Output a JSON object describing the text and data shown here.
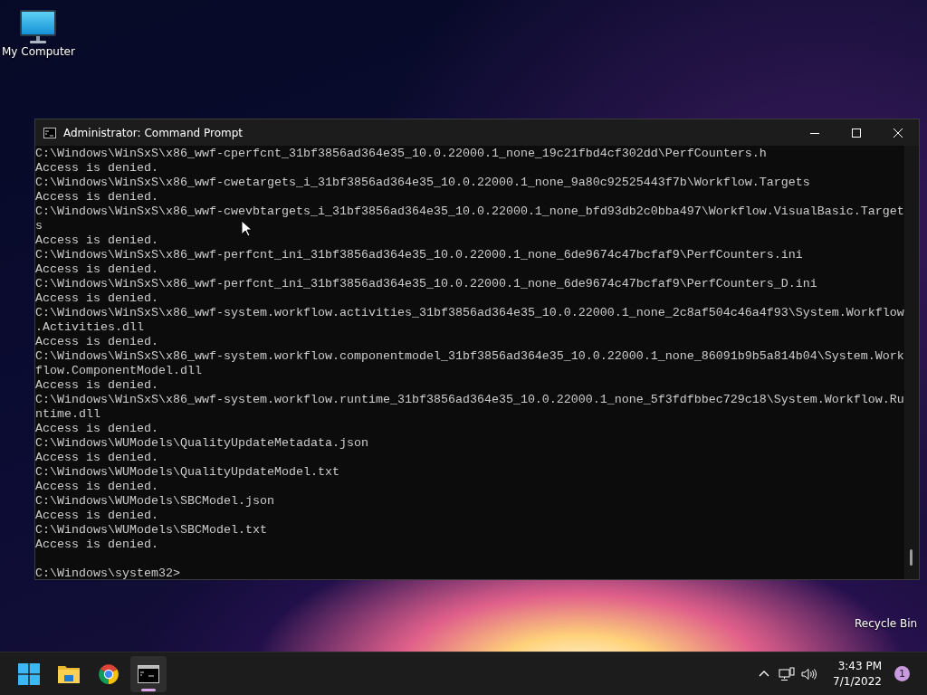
{
  "desktop_icons": [
    {
      "kind": "computer",
      "label": "My Computer"
    },
    {
      "kind": "recycle-bin",
      "label": "Recycle Bin"
    }
  ],
  "window": {
    "title": "Administrator: Command Prompt",
    "lines": [
      "C:\\Windows\\WinSxS\\x86_wwf-cperfcnt_31bf3856ad364e35_10.0.22000.1_none_19c21fbd4cf302dd\\PerfCounters.h",
      "Access is denied.",
      "C:\\Windows\\WinSxS\\x86_wwf-cwetargets_i_31bf3856ad364e35_10.0.22000.1_none_9a80c92525443f7b\\Workflow.Targets",
      "Access is denied.",
      "C:\\Windows\\WinSxS\\x86_wwf-cwevbtargets_i_31bf3856ad364e35_10.0.22000.1_none_bfd93db2c0bba497\\Workflow.VisualBasic.Target",
      "s",
      "Access is denied.",
      "C:\\Windows\\WinSxS\\x86_wwf-perfcnt_ini_31bf3856ad364e35_10.0.22000.1_none_6de9674c47bcfaf9\\PerfCounters.ini",
      "Access is denied.",
      "C:\\Windows\\WinSxS\\x86_wwf-perfcnt_ini_31bf3856ad364e35_10.0.22000.1_none_6de9674c47bcfaf9\\PerfCounters_D.ini",
      "Access is denied.",
      "C:\\Windows\\WinSxS\\x86_wwf-system.workflow.activities_31bf3856ad364e35_10.0.22000.1_none_2c8af504c46a4f93\\System.Workflow",
      ".Activities.dll",
      "Access is denied.",
      "C:\\Windows\\WinSxS\\x86_wwf-system.workflow.componentmodel_31bf3856ad364e35_10.0.22000.1_none_86091b9b5a814b04\\System.Work",
      "flow.ComponentModel.dll",
      "Access is denied.",
      "C:\\Windows\\WinSxS\\x86_wwf-system.workflow.runtime_31bf3856ad364e35_10.0.22000.1_none_5f3fdfbbec729c18\\System.Workflow.Ru",
      "ntime.dll",
      "Access is denied.",
      "C:\\Windows\\WUModels\\QualityUpdateMetadata.json",
      "Access is denied.",
      "C:\\Windows\\WUModels\\QualityUpdateModel.txt",
      "Access is denied.",
      "C:\\Windows\\WUModels\\SBCModel.json",
      "Access is denied.",
      "C:\\Windows\\WUModels\\SBCModel.txt",
      "Access is denied."
    ],
    "prompt": "C:\\Windows\\system32>"
  },
  "taskbar": {
    "apps": [
      {
        "kind": "start",
        "active": false
      },
      {
        "kind": "folder",
        "active": false
      },
      {
        "kind": "browser",
        "active": false
      },
      {
        "kind": "terminal",
        "active": true
      }
    ],
    "tray": {
      "time": "3:43 PM",
      "date": "7/1/2022",
      "notification_count": "1"
    }
  }
}
